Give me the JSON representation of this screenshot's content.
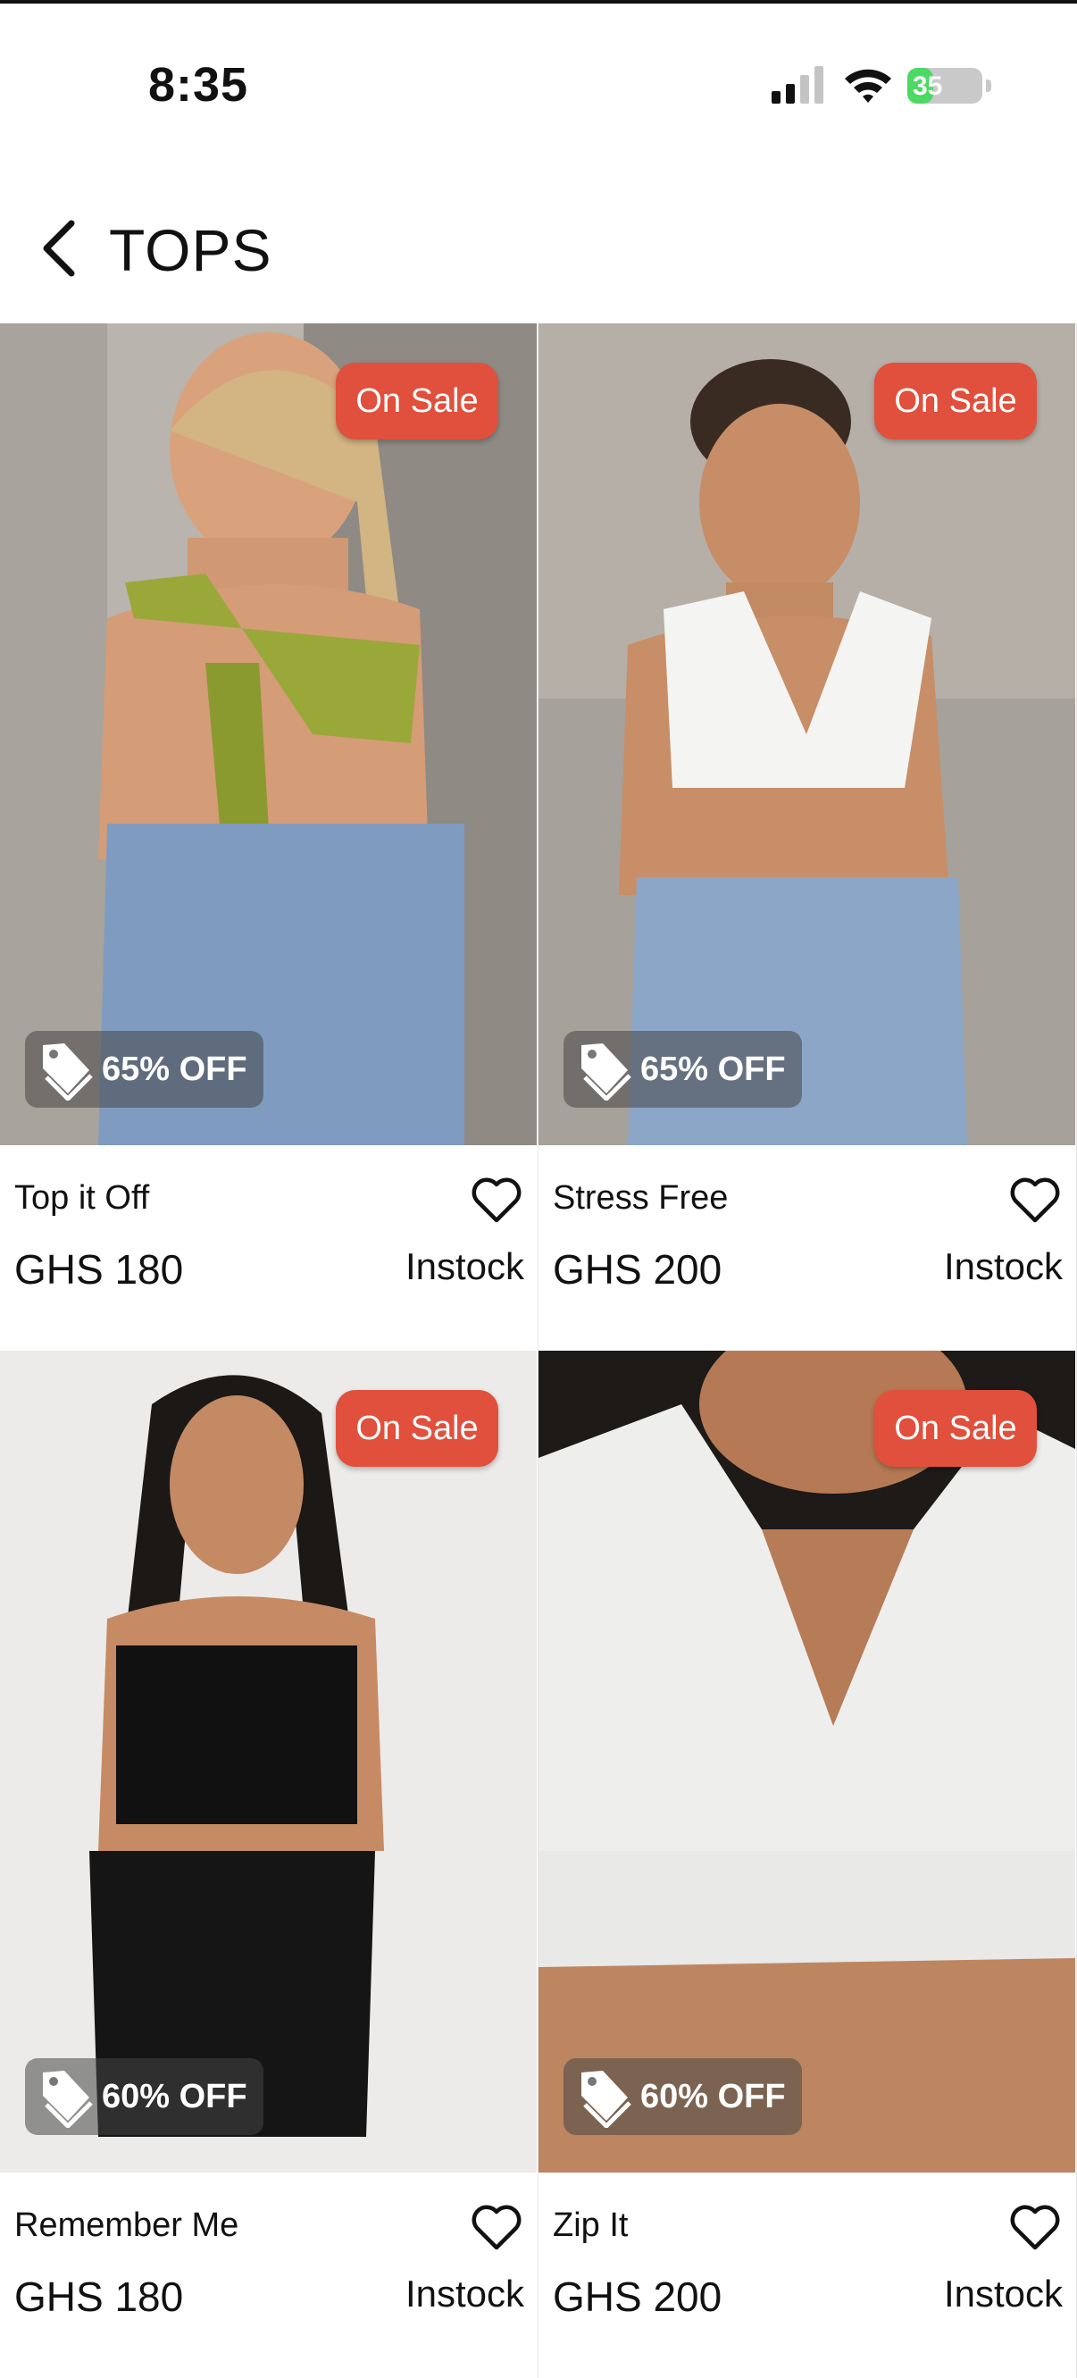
{
  "status_bar": {
    "time": "8:35",
    "battery": "35",
    "battery_level": 0.35
  },
  "header": {
    "title": "TOPS"
  },
  "products": [
    {
      "name": "Top it Off",
      "price": "GHS 180",
      "stock": "Instock",
      "sale": "On Sale",
      "discount": "65% OFF"
    },
    {
      "name": "Stress Free",
      "price": "GHS 200",
      "stock": "Instock",
      "sale": "On Sale",
      "discount": "65% OFF"
    },
    {
      "name": "Remember Me",
      "price": "GHS 180",
      "stock": "Instock",
      "sale": "On Sale",
      "discount": "60% OFF"
    },
    {
      "name": "Zip It",
      "price": "GHS 200",
      "stock": "Instock",
      "sale": "On Sale",
      "discount": "60% OFF"
    }
  ],
  "icons": {
    "back": "chevron-left-icon",
    "favorite": "heart-icon",
    "discount": "price-tag-icon"
  },
  "colors": {
    "sale_badge": "#e0503c",
    "battery": "#4cd964"
  }
}
